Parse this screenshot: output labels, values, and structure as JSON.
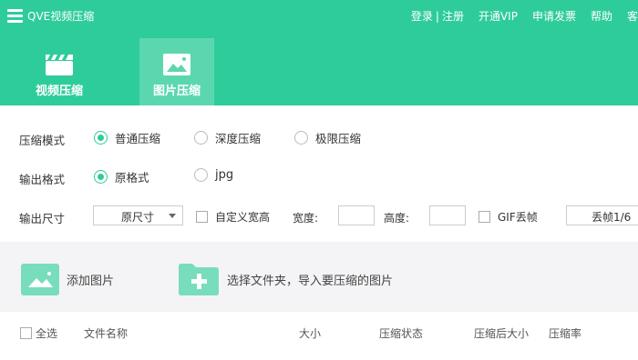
{
  "app": {
    "title": "QVE视频压缩"
  },
  "top_menu": {
    "login": "登录",
    "divider": "|",
    "register": "注册",
    "vip": "开通VIP",
    "invoice": "申请发票",
    "help": "帮助",
    "more": "客"
  },
  "tabs": [
    {
      "label": "视频压缩",
      "icon": "video-clapper-icon",
      "active": false
    },
    {
      "label": "图片压缩",
      "icon": "image-icon",
      "active": true
    }
  ],
  "settings": {
    "mode_label": "压缩模式",
    "modes": [
      {
        "label": "普通压缩",
        "selected": true
      },
      {
        "label": "深度压缩",
        "selected": false
      },
      {
        "label": "极限压缩",
        "selected": false
      }
    ],
    "format_label": "输出格式",
    "formats": [
      {
        "label": "原格式",
        "selected": true
      },
      {
        "label": "jpg",
        "selected": false
      }
    ],
    "size_label": "输出尺寸",
    "size_value": "原尺寸",
    "custom_label": "自定义宽高",
    "width_label": "宽度:",
    "height_label": "高度:",
    "gif_label": "GIF丢帧",
    "gif_value": "丢帧1/6"
  },
  "actions": {
    "add_image": "添加图片",
    "add_folder": "选择文件夹，导入要压缩的图片"
  },
  "table": {
    "select_all": "全选",
    "columns": [
      "文件名称",
      "大小",
      "压缩状态",
      "压缩后大小",
      "压缩率"
    ]
  },
  "colors": {
    "accent": "#2ecc9a",
    "icon_light": "#77ddbc"
  }
}
